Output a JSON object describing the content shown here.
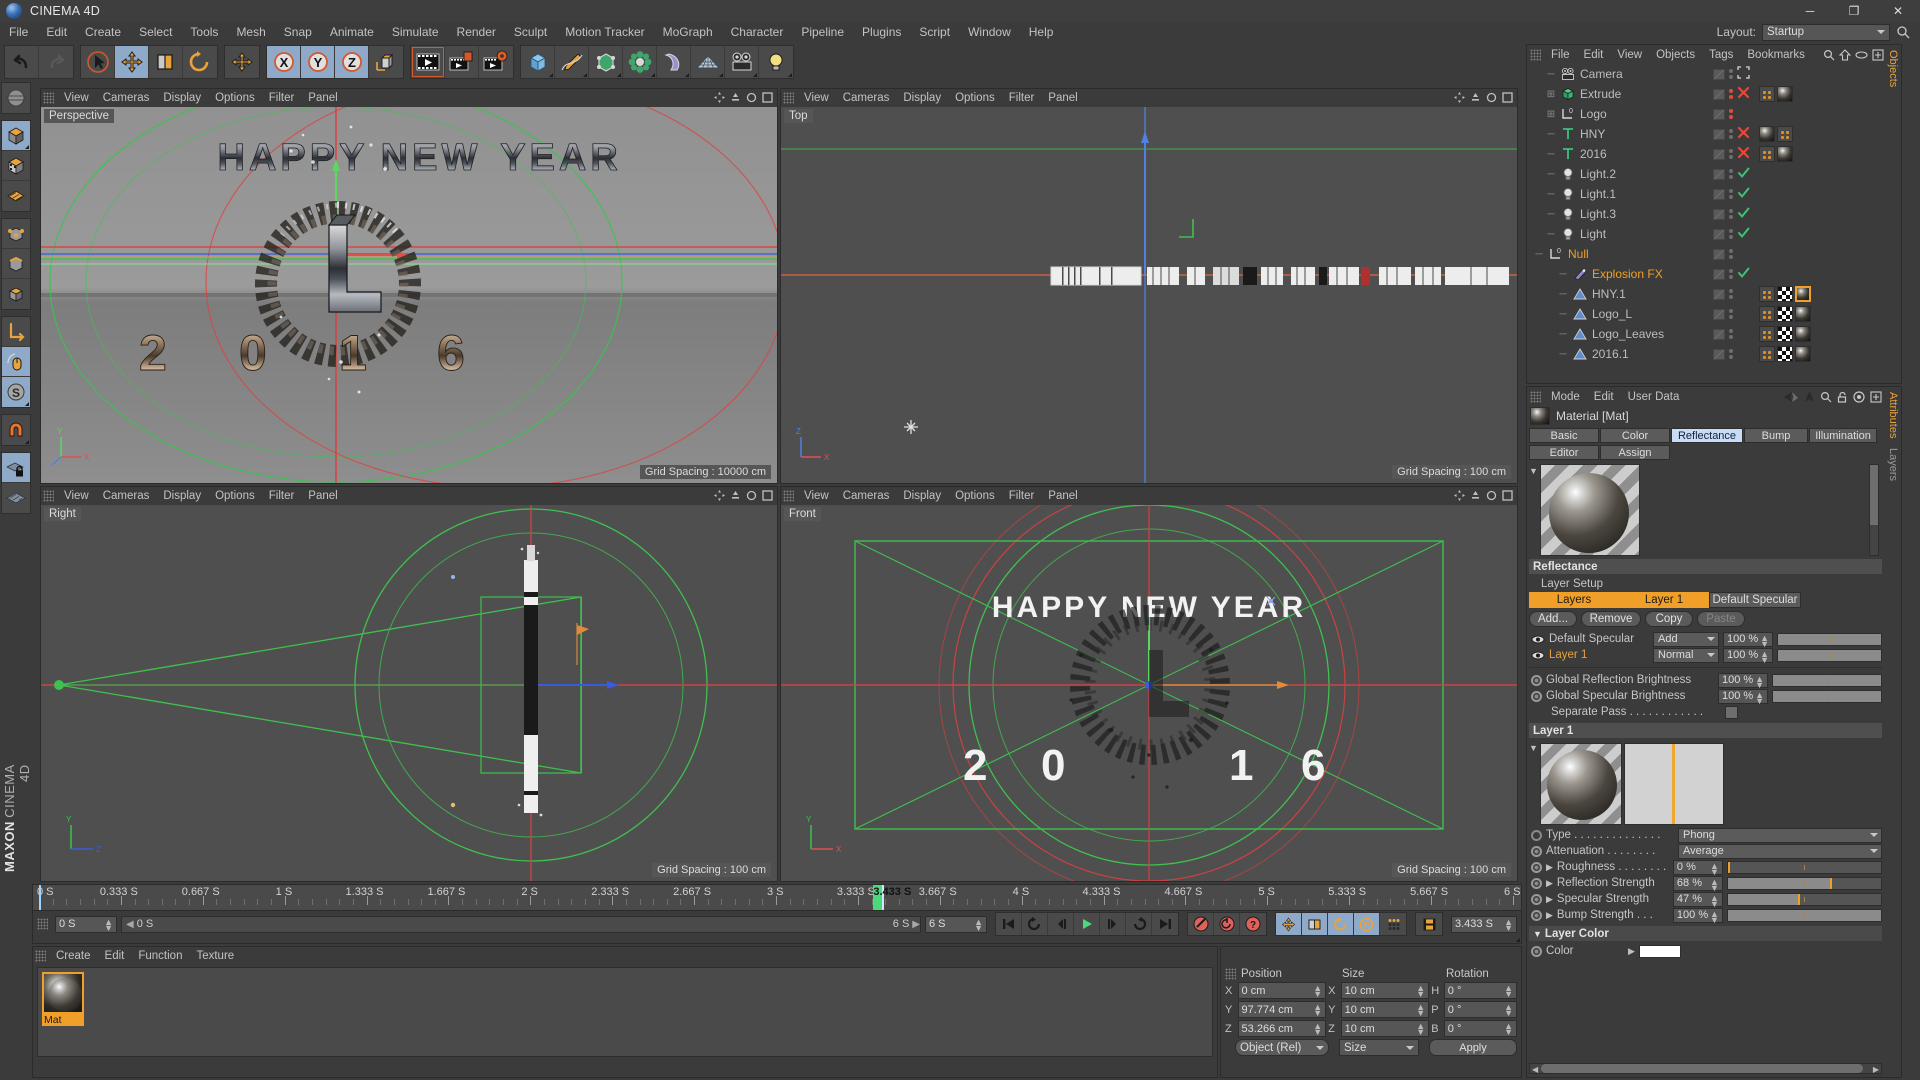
{
  "app": {
    "title": "CINEMA 4D",
    "brand_top": "MAXON",
    "brand_bottom": "CINEMA 4D",
    "window_buttons": {
      "minimize": "─",
      "maximize": "❐",
      "close": "✕"
    }
  },
  "menubar": {
    "items": [
      "File",
      "Edit",
      "Create",
      "Select",
      "Tools",
      "Mesh",
      "Snap",
      "Animate",
      "Simulate",
      "Render",
      "Sculpt",
      "Motion Tracker",
      "MoGraph",
      "Character",
      "Pipeline",
      "Plugins",
      "Script",
      "Window",
      "Help"
    ],
    "layout_label": "Layout:",
    "layout_value": "Startup"
  },
  "toolbar": {
    "groups": [
      {
        "name": "undo-redo",
        "buttons": [
          {
            "icon": "undo-icon",
            "label": "Undo",
            "state": "normal"
          },
          {
            "icon": "redo-icon",
            "label": "Redo",
            "state": "disabled"
          }
        ]
      },
      {
        "name": "transform",
        "buttons": [
          {
            "icon": "select-cursor-icon",
            "label": "Live Selection",
            "state": "outlined"
          },
          {
            "icon": "move-icon",
            "label": "Move",
            "state": "active"
          },
          {
            "icon": "scale-icon",
            "label": "Scale",
            "state": "normal"
          },
          {
            "icon": "rotate-icon",
            "label": "Rotate",
            "state": "normal"
          }
        ]
      },
      {
        "name": "world-axis",
        "buttons": [
          {
            "icon": "world-axis-icon",
            "label": "Coordinate System",
            "state": "normal"
          }
        ]
      },
      {
        "name": "axis-locks",
        "buttons": [
          {
            "icon": "x-axis-icon",
            "label": "X-Axis",
            "state": "active"
          },
          {
            "icon": "y-axis-icon",
            "label": "Y-Axis",
            "state": "active"
          },
          {
            "icon": "z-axis-icon",
            "label": "Z-Axis",
            "state": "active"
          },
          {
            "icon": "object-world-icon",
            "label": "Object/World",
            "state": "normal"
          }
        ]
      },
      {
        "name": "render",
        "buttons": [
          {
            "icon": "render-view-icon",
            "label": "Render View",
            "state": "outlined"
          },
          {
            "icon": "render-picture-viewer-icon",
            "label": "Render to Picture Viewer",
            "state": "normal"
          },
          {
            "icon": "render-settings-icon",
            "label": "Edit Render Settings",
            "state": "normal"
          }
        ]
      },
      {
        "name": "primitives",
        "buttons": [
          {
            "icon": "cube-primitive-icon",
            "label": "Cube",
            "state": "normal"
          },
          {
            "icon": "spline-pen-icon",
            "label": "Pen",
            "state": "normal"
          },
          {
            "icon": "generator-icon",
            "label": "Array",
            "state": "normal"
          },
          {
            "icon": "mograph-cloner-icon",
            "label": "Cloner",
            "state": "normal"
          },
          {
            "icon": "deformer-bend-icon",
            "label": "Bend",
            "state": "normal"
          },
          {
            "icon": "environment-floor-icon",
            "label": "Floor",
            "state": "normal"
          },
          {
            "icon": "camera-icon",
            "label": "Camera",
            "state": "normal"
          },
          {
            "icon": "light-icon",
            "label": "Light",
            "state": "normal"
          }
        ]
      }
    ]
  },
  "left_toolbar": {
    "buttons": [
      {
        "icon": "make-editable-icon",
        "label": "Make Editable",
        "state": "normal"
      },
      {
        "icon": "model-mode-icon",
        "label": "Model Mode",
        "state": "active"
      },
      {
        "icon": "texture-mode-icon",
        "label": "Texture Mode",
        "state": "normal"
      },
      {
        "icon": "workplane-icon",
        "label": "Workplane",
        "state": "normal"
      },
      {
        "icon": "point-mode-icon",
        "label": "Points",
        "state": "normal"
      },
      {
        "icon": "edge-mode-icon",
        "label": "Edges",
        "state": "normal"
      },
      {
        "icon": "polygon-mode-icon",
        "label": "Polygons",
        "state": "normal"
      },
      {
        "icon": "axis-modify-icon",
        "label": "Enable Axis Modification",
        "state": "normal"
      },
      {
        "icon": "viewport-solo-icon",
        "label": "Viewport Solo",
        "state": "active"
      },
      {
        "icon": "snap-s-icon",
        "label": "Enable Snapping",
        "state": "active"
      },
      {
        "icon": "magnet-icon",
        "label": "Magnet",
        "state": "normal"
      },
      {
        "icon": "workplane-lock-icon",
        "label": "Lock Workplane",
        "state": "active"
      },
      {
        "icon": "workplane-grid-icon",
        "label": "Planar Workplane",
        "state": "normal"
      }
    ]
  },
  "viewports": {
    "menus": [
      "View",
      "Cameras",
      "Display",
      "Options",
      "Filter",
      "Panel"
    ],
    "items": [
      {
        "name": "Perspective",
        "grid": "Grid Spacing : 10000 cm"
      },
      {
        "name": "Top",
        "grid": "Grid Spacing : 100 cm"
      },
      {
        "name": "Right",
        "grid": "Grid Spacing : 100 cm"
      },
      {
        "name": "Front",
        "grid": "Grid Spacing : 100 cm"
      }
    ],
    "scene_text": {
      "headline": "HAPPY NEW YEAR",
      "year_digits": [
        "2",
        "0",
        "1",
        "6"
      ]
    }
  },
  "timeline": {
    "tick_labels": [
      "0 S",
      "0.333 S",
      "0.667 S",
      "1 S",
      "1.333 S",
      "1.667 S",
      "2 S",
      "2.333 S",
      "2.667 S",
      "3 S",
      "3.333 S",
      "3.667 S",
      "4 S",
      "4.333 S",
      "4.667 S",
      "5 S",
      "5.333 S",
      "5.667 S",
      "6 S"
    ],
    "current_time_marker": "3.433 S",
    "current_time_field": "3.433 S",
    "start_field": "0 S",
    "preview_min": "0 S",
    "preview_max": "6 S",
    "end_field": "6 S",
    "transport": [
      {
        "icon": "go-to-start-icon",
        "label": "Go to Start"
      },
      {
        "icon": "previous-key-icon",
        "label": "Go to Previous Key"
      },
      {
        "icon": "step-back-icon",
        "label": "Go to Previous Frame"
      },
      {
        "icon": "play-icon",
        "label": "Play Forwards"
      },
      {
        "icon": "step-forward-icon",
        "label": "Go to Next Frame"
      },
      {
        "icon": "next-key-icon",
        "label": "Go to Next Key"
      },
      {
        "icon": "go-to-end-icon",
        "label": "Go to End"
      }
    ],
    "record_group": [
      {
        "icon": "record-key-icon",
        "label": "Record Active Objects"
      },
      {
        "icon": "autokey-icon",
        "label": "Autokeying"
      },
      {
        "icon": "keyframe-selection-icon",
        "label": "Keyframe Selection"
      }
    ],
    "param_group": [
      {
        "icon": "position-key-icon",
        "label": "Position",
        "state": "active"
      },
      {
        "icon": "scale-key-icon",
        "label": "Scale",
        "state": "active"
      },
      {
        "icon": "rotation-key-icon",
        "label": "Rotation",
        "state": "active"
      },
      {
        "icon": "pla-key-icon",
        "label": "Point Level Animation",
        "state": "active"
      },
      {
        "icon": "param-key-icon",
        "label": "Parameter",
        "state": "normal"
      }
    ],
    "extra_group": [
      {
        "icon": "timeline-icon",
        "label": "Timeline"
      }
    ]
  },
  "material_manager": {
    "menus": [
      "Create",
      "Edit",
      "Function",
      "Texture"
    ],
    "materials": [
      {
        "name": "Mat",
        "selected": true
      }
    ]
  },
  "coordinates": {
    "headers": [
      "Position",
      "Size",
      "Rotation"
    ],
    "position": {
      "labels": [
        "X",
        "Y",
        "Z"
      ],
      "values": [
        "0 cm",
        "97.774 cm",
        "53.266 cm"
      ]
    },
    "size": {
      "labels": [
        "X",
        "Y",
        "Z"
      ],
      "values": [
        "10 cm",
        "10 cm",
        "10 cm"
      ]
    },
    "rotation": {
      "labels": [
        "H",
        "P",
        "B"
      ],
      "values": [
        "0 °",
        "0 °",
        "0 °"
      ]
    },
    "mode_value": "Object (Rel)",
    "size_value": "Size",
    "apply_label": "Apply"
  },
  "object_manager": {
    "menus": [
      "File",
      "Edit",
      "View",
      "Objects",
      "Tags",
      "Bookmarks"
    ],
    "header_icons": [
      "search-icon",
      "up-level-icon",
      "visibility-icon",
      "add-layer-icon"
    ],
    "side_tab": "Objects",
    "rows": [
      {
        "label": "Camera",
        "icon": "camera-object-icon",
        "indent": 1,
        "tree": "-",
        "selected": false,
        "dots": "gray",
        "vis_tag": "fit-icon",
        "tags": []
      },
      {
        "label": "Extrude",
        "icon": "extrude-object-icon",
        "indent": 1,
        "tree": "+",
        "selected": false,
        "dots": "red",
        "vis_tag": "x-red-icon",
        "tags": [
          "dots",
          "mat"
        ]
      },
      {
        "label": "Logo",
        "icon": "null-object-icon",
        "indent": 1,
        "tree": "+",
        "selected": false,
        "dots": "red",
        "vis_tag": "",
        "tags": []
      },
      {
        "label": "HNY",
        "icon": "text-spline-icon",
        "indent": 1,
        "tree": "-",
        "selected": false,
        "dots": "gray",
        "vis_tag": "x-red-icon",
        "tags": [
          "mat",
          "dots"
        ]
      },
      {
        "label": "2016",
        "icon": "text-spline-icon",
        "indent": 1,
        "tree": "-",
        "selected": false,
        "dots": "gray",
        "vis_tag": "x-red-icon",
        "tags": [
          "dots",
          "mat"
        ]
      },
      {
        "label": "Light.2",
        "icon": "light-object-icon",
        "indent": 1,
        "tree": "-",
        "selected": false,
        "dots": "gray",
        "vis_tag": "check-icon",
        "tags": []
      },
      {
        "label": "Light.1",
        "icon": "light-object-icon",
        "indent": 1,
        "tree": "-",
        "selected": false,
        "dots": "gray",
        "vis_tag": "check-icon",
        "tags": []
      },
      {
        "label": "Light.3",
        "icon": "light-object-icon",
        "indent": 1,
        "tree": "-",
        "selected": false,
        "dots": "gray",
        "vis_tag": "check-icon",
        "tags": []
      },
      {
        "label": "Light",
        "icon": "light-object-icon",
        "indent": 1,
        "tree": "-",
        "selected": false,
        "dots": "gray",
        "vis_tag": "check-icon",
        "tags": []
      },
      {
        "label": "Null",
        "icon": "null-object-icon",
        "indent": 0,
        "tree": "-",
        "selected": true,
        "dots": "gray",
        "vis_tag": "",
        "tags": []
      },
      {
        "label": "Explosion FX",
        "icon": "explosionfx-icon",
        "indent": 2,
        "tree": "-",
        "selected": true,
        "dots": "gray",
        "vis_tag": "check-icon",
        "tags": []
      },
      {
        "label": "HNY.1",
        "icon": "polygon-object-icon",
        "indent": 2,
        "tree": "-",
        "selected": false,
        "dots": "gray",
        "vis_tag": "",
        "tags": [
          "dots",
          "chk",
          "mat-sel"
        ]
      },
      {
        "label": "Logo_L",
        "icon": "polygon-object-icon",
        "indent": 2,
        "tree": "-",
        "selected": false,
        "dots": "gray",
        "vis_tag": "",
        "tags": [
          "dots",
          "chk",
          "mat"
        ]
      },
      {
        "label": "Logo_Leaves",
        "icon": "polygon-object-icon",
        "indent": 2,
        "tree": "-",
        "selected": false,
        "dots": "gray",
        "vis_tag": "",
        "tags": [
          "dots",
          "chk",
          "mat"
        ]
      },
      {
        "label": "2016.1",
        "icon": "polygon-object-icon",
        "indent": 2,
        "tree": "-",
        "selected": false,
        "dots": "gray",
        "vis_tag": "",
        "tags": [
          "dots",
          "chk",
          "mat"
        ]
      }
    ]
  },
  "attributes": {
    "menus": [
      "Mode",
      "Edit",
      "User Data"
    ],
    "header_icons": [
      "back-arrow-icon",
      "up-arrow-icon",
      "search-icon",
      "unlock-icon",
      "target-icon",
      "add-icon"
    ],
    "side_tabs": [
      "Attributes",
      "Layers"
    ],
    "object_title": "Material [Mat]",
    "tabs_row1": [
      {
        "label": "Basic",
        "active": false
      },
      {
        "label": "Color",
        "active": false
      },
      {
        "label": "Reflectance",
        "active": true
      },
      {
        "label": "Bump",
        "active": false
      },
      {
        "label": "Illumination",
        "active": false
      }
    ],
    "tabs_row2": [
      {
        "label": "Editor",
        "active": false
      },
      {
        "label": "Assign",
        "active": false
      }
    ],
    "reflectance": {
      "section_title": "Reflectance",
      "layer_setup_label": "Layer Setup",
      "bands": [
        {
          "label": "Layers",
          "style": "orange"
        },
        {
          "label": "Layer 1",
          "style": "orange"
        },
        {
          "label": "Default Specular",
          "style": "gray"
        }
      ],
      "buttons": [
        {
          "label": "Add...",
          "disabled": false
        },
        {
          "label": "Remove",
          "disabled": false
        },
        {
          "label": "Copy",
          "disabled": false
        },
        {
          "label": "Paste",
          "disabled": true
        }
      ],
      "layers": [
        {
          "name": "Default Specular",
          "highlight": false,
          "blend": "Add",
          "opacity": "100 %",
          "opacity_pct": 100
        },
        {
          "name": "Layer 1",
          "highlight": true,
          "blend": "Normal",
          "opacity": "100 %",
          "opacity_pct": 100
        }
      ],
      "globals": [
        {
          "label": "Global Reflection Brightness",
          "value": "100 %",
          "pct": 100
        },
        {
          "label": "Global Specular Brightness",
          "value": "100 %",
          "pct": 100
        }
      ],
      "separate_pass": {
        "label": "Separate Pass . . . . . . . . . . . .",
        "checked": false
      }
    },
    "layer1": {
      "section_title": "Layer 1",
      "rows": [
        {
          "label": "Type . . . . . . . . . . . . . .",
          "type": "dropdown",
          "value": "Phong"
        },
        {
          "label": "Attenuation . . . . . . . .",
          "type": "dropdown",
          "value": "Average"
        },
        {
          "label": "Roughness . . . . . . . .",
          "type": "slider",
          "value": "0 %",
          "pct": 0
        },
        {
          "label": "Reflection Strength",
          "type": "slider",
          "value": "68 %",
          "pct": 68
        },
        {
          "label": "Specular Strength",
          "type": "slider",
          "value": "47 %",
          "pct": 47
        },
        {
          "label": "Bump Strength . . .",
          "type": "slider",
          "value": "100 %",
          "pct": 100
        }
      ],
      "layer_color": {
        "title": "Layer Color",
        "color_label": "Color",
        "color_hex": "#ffffff"
      }
    }
  }
}
